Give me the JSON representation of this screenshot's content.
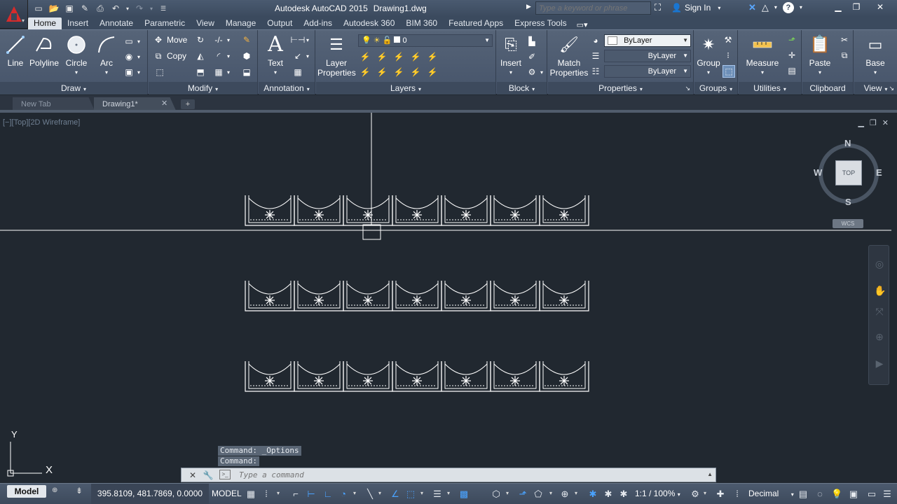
{
  "titlebar": {
    "app_name": "Autodesk AutoCAD 2015",
    "document": "Drawing1.dwg",
    "search_placeholder": "Type a keyword or phrase",
    "signin": "Sign In",
    "help": "?"
  },
  "ribbon_tabs": [
    "Home",
    "Insert",
    "Annotate",
    "Parametric",
    "View",
    "Manage",
    "Output",
    "Add-ins",
    "Autodesk 360",
    "BIM 360",
    "Featured Apps",
    "Express Tools"
  ],
  "ribbon": {
    "draw": {
      "title": "Draw",
      "line": "Line",
      "polyline": "Polyline",
      "circle": "Circle",
      "arc": "Arc"
    },
    "modify": {
      "title": "Modify",
      "move": "Move",
      "copy": "Copy"
    },
    "annotation": {
      "title": "Annotation",
      "text": "Text"
    },
    "layers": {
      "title": "Layers",
      "layer_properties_1": "Layer",
      "layer_properties_2": "Properties",
      "current_layer": "0"
    },
    "block": {
      "title": "Block",
      "insert": "Insert"
    },
    "properties": {
      "title": "Properties",
      "match_1": "Match",
      "match_2": "Properties",
      "color": "ByLayer",
      "linetype": "ByLayer",
      "lineweight": "ByLayer"
    },
    "groups": {
      "title": "Groups",
      "group": "Group"
    },
    "utilities": {
      "title": "Utilities",
      "measure": "Measure"
    },
    "clipboard": {
      "title": "Clipboard",
      "paste": "Paste"
    },
    "view": {
      "title": "View",
      "base": "Base"
    }
  },
  "file_tabs": {
    "new_tab": "New Tab",
    "drawing": "Drawing1*"
  },
  "viewport": {
    "label": "[−][Top][2D Wireframe]",
    "viewcube": {
      "top": "TOP",
      "n": "N",
      "s": "S",
      "e": "E",
      "w": "W",
      "wcs": "WCS"
    },
    "ucs": {
      "x": "X",
      "y": "Y"
    }
  },
  "command": {
    "history": [
      "Command: _Options",
      "Command:"
    ],
    "placeholder": "Type a command"
  },
  "statusbar": {
    "model_tab": "Model",
    "coordinates": "395.8109, 481.7869, 0.0000",
    "space": "MODEL",
    "annotation_scale": "1:1 / 100%",
    "units": "Decimal"
  },
  "colors": {
    "background": "#212830",
    "ribbon": "#4e5c70",
    "linework": "#ffffff",
    "accent": "#4aa3ff",
    "logo": "#d62b2b"
  }
}
